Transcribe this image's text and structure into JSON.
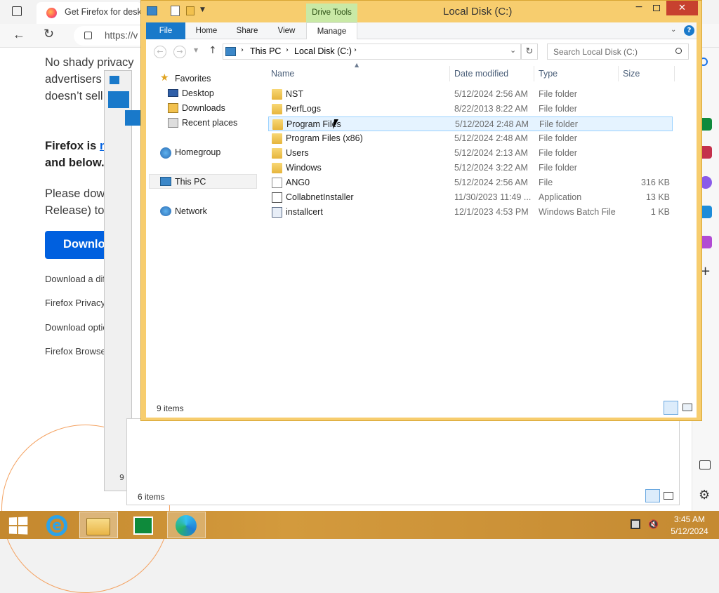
{
  "browser": {
    "tab_title": "Get Firefox for deskt",
    "url": "https://v",
    "page": {
      "para1": [
        "No shady privacy",
        "advertisers",
        "doesn’t sell"
      ],
      "bold_line1_prefix": "Firefox is ",
      "bold_line1_link": "n",
      "bold_line2": "and below.",
      "para2": [
        "Please dow",
        "Release) to"
      ],
      "download_button": "Downlo",
      "links": [
        "Download a dif",
        "Firefox Privacy",
        "Download optio",
        "Firefox Browse"
      ]
    }
  },
  "background_window": {
    "status": "6 items",
    "left_fragment": "9"
  },
  "explorer": {
    "title": "Local Disk (C:)",
    "contextual_tab_group": "Drive Tools",
    "ribbon_tabs": [
      "File",
      "Home",
      "Share",
      "View",
      "Manage"
    ],
    "breadcrumb": [
      "This PC",
      "Local Disk (C:)"
    ],
    "search_placeholder": "Search Local Disk (C:)",
    "nav": {
      "favorites": "Favorites",
      "desktop": "Desktop",
      "downloads": "Downloads",
      "recent": "Recent places",
      "homegroup": "Homegroup",
      "thispc": "This PC",
      "network": "Network"
    },
    "columns": {
      "name": "Name",
      "date": "Date modified",
      "type": "Type",
      "size": "Size"
    },
    "rows": [
      {
        "name": "NST",
        "date": "5/12/2024 2:56 AM",
        "type": "File folder",
        "size": "",
        "icon": "folder-icon"
      },
      {
        "name": "PerfLogs",
        "date": "8/22/2013 8:22 AM",
        "type": "File folder",
        "size": "",
        "icon": "folder-icon"
      },
      {
        "name": "Program Files",
        "date": "5/12/2024 2:48 AM",
        "type": "File folder",
        "size": "",
        "icon": "folder-icon"
      },
      {
        "name": "Program Files (x86)",
        "date": "5/12/2024 2:48 AM",
        "type": "File folder",
        "size": "",
        "icon": "folder-icon"
      },
      {
        "name": "Users",
        "date": "5/12/2024 2:13 AM",
        "type": "File folder",
        "size": "",
        "icon": "folder-icon"
      },
      {
        "name": "Windows",
        "date": "5/12/2024 3:22 AM",
        "type": "File folder",
        "size": "",
        "icon": "folder-icon"
      },
      {
        "name": "ANG0",
        "date": "5/12/2024 2:56 AM",
        "type": "File",
        "size": "316 KB",
        "icon": "file-icon"
      },
      {
        "name": "CollabnetInstaller",
        "date": "11/30/2023 11:49 ...",
        "type": "Application",
        "size": "13 KB",
        "icon": "application-icon"
      },
      {
        "name": "installcert",
        "date": "12/1/2023 4:53 PM",
        "type": "Windows Batch File",
        "size": "1 KB",
        "icon": "batch-file-icon"
      }
    ],
    "status": "9 items"
  },
  "taskbar": {
    "time": "3:45 AM",
    "date": "5/12/2024"
  },
  "colors": {
    "explorer_frame": "#f7cd6e",
    "file_tab": "#1979ca",
    "taskbar": "#c98f36",
    "download_button": "#0060df",
    "selection": "#cce8ff"
  }
}
